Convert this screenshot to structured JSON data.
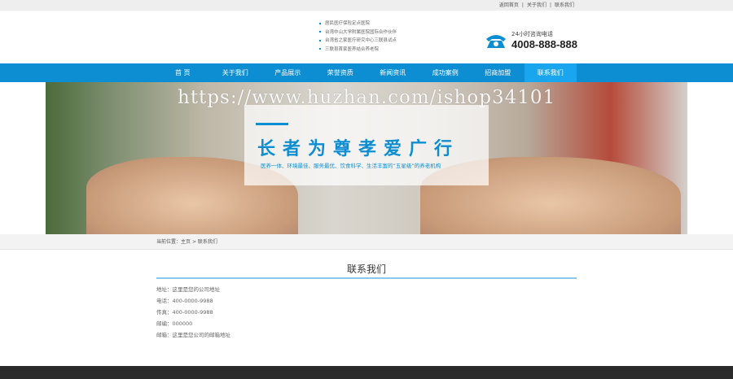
{
  "topbar": {
    "links": [
      "返回首页",
      "关于我们",
      "联系我们"
    ],
    "sep": "|"
  },
  "header": {
    "bullets": [
      "居民医疗保险定点医院",
      "台湾中山大学附属医院国际合作伙伴",
      "台湾省之家医疗研究中心三联县试点",
      "三联县首家医养结合养老院"
    ],
    "hotline_label": "24小时咨询电话",
    "hotline": "4008-888-888"
  },
  "nav": {
    "items": [
      "首 页",
      "关于我们",
      "产品展示",
      "荣誉资质",
      "新闻资讯",
      "成功案例",
      "招商加盟",
      "联系我们"
    ],
    "active": 7
  },
  "banner": {
    "watermark": "https://www.huzhan.com/ishop34101",
    "title": "长者为尊孝爱广行",
    "subtitle": "医养一体、环境最佳、服务最优、饮食科学、生活丰富的“五星级”的养老机构"
  },
  "breadcrumb": {
    "label": "当前位置：",
    "home": "主页",
    "arrow": ">",
    "current": "联系我们"
  },
  "content": {
    "title": "联系我们",
    "lines": [
      "地址：这里是您的公司地址",
      "电话：400-0000-9988",
      "传真：400-0000-9988",
      "邮编：000000",
      "邮箱：这里是您公司的邮箱地址"
    ]
  },
  "colors": {
    "brand": "#0d8ed2",
    "active": "#1aa6ee"
  }
}
